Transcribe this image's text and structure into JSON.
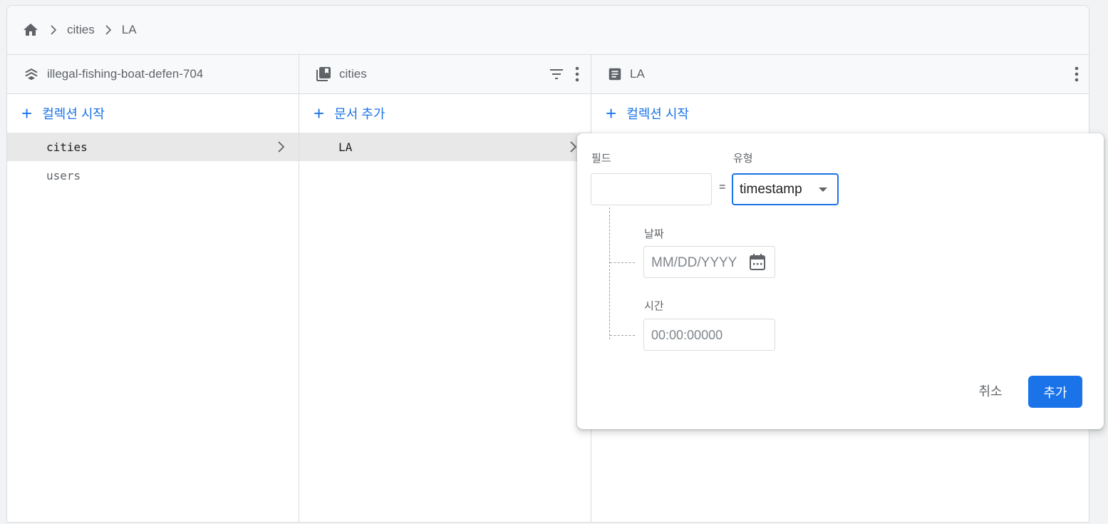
{
  "breadcrumb": {
    "home_icon": "home-icon",
    "items": [
      "cities",
      "LA"
    ]
  },
  "panels": {
    "root": {
      "title": "illegal-fishing-boat-defen-704",
      "icon": "database-icon",
      "add_label": "컬렉션 시작",
      "items": [
        {
          "label": "cities",
          "selected": true
        },
        {
          "label": "users",
          "selected": false
        }
      ]
    },
    "collection": {
      "title": "cities",
      "icon": "collection-icon",
      "add_label": "문서 추가",
      "items": [
        {
          "label": "LA",
          "selected": true
        }
      ]
    },
    "document": {
      "title": "LA",
      "icon": "document-icon",
      "add_label": "컬렉션 시작"
    }
  },
  "popup": {
    "field_label": "필드",
    "type_label": "유형",
    "field_value": "",
    "equals": "=",
    "type_value": "timestamp",
    "date_label": "날짜",
    "date_placeholder": "MM/DD/YYYY",
    "time_label": "시간",
    "time_placeholder": "00:00:00000",
    "cancel_label": "취소",
    "add_label": "추가"
  },
  "colors": {
    "accent": "#1a73e8",
    "selected_row": "#e8e8e8",
    "header_bg": "#f8f9fa"
  }
}
